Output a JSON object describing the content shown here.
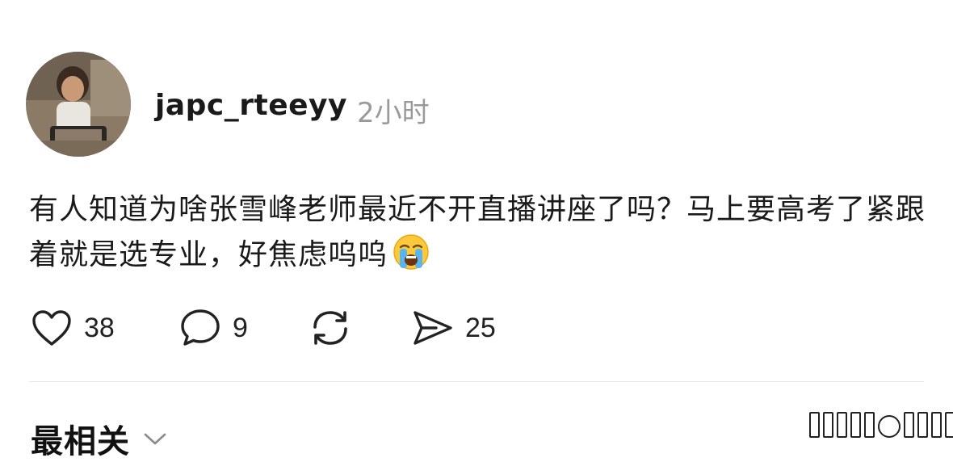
{
  "post": {
    "username": "japc_rteeyy",
    "timestamp": "2小时",
    "text": "有人知道为啥张雪峰老师最近不开直播讲座了吗？马上要高考了紧跟着就是选专业，好焦虑呜呜",
    "emoji": "loudly-crying-face"
  },
  "actions": {
    "likes": "38",
    "comments": "9",
    "reposts_icon": "repost-icon",
    "shares": "25"
  },
  "sort": {
    "label": "最相关"
  },
  "colors": {
    "text": "#1a1a1a",
    "muted": "#9a9a9a",
    "divider": "#e6e6e6"
  }
}
